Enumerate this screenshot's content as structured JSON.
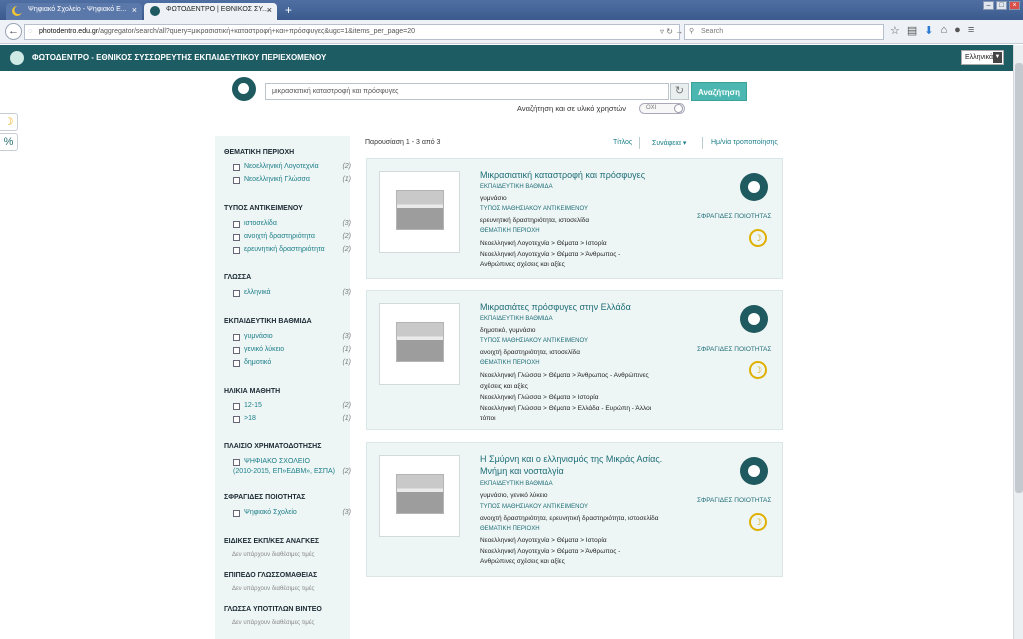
{
  "browser": {
    "tabs": [
      {
        "title": "Ψηφιακό Σχολείο - Ψηφιακό Ε..."
      },
      {
        "title": "ΦΩΤΟΔΕΝΤΡΟ | ΕΘΝΙΚΟΣ ΣΥ..."
      }
    ],
    "new_tab": "+",
    "url_host": "photodentro.edu.gr",
    "url_path": "/aggregator/search/all?query=μικρασιατική+καταστροφή+και+πρόσφυγες&ugc=1&items_per_page=20",
    "search_placeholder": "Search",
    "close_glyph": "×"
  },
  "site": {
    "title": "ΦΩΤΟΔΕΝΤΡΟ - ΕΘΝΙΚΟΣ ΣΥΣΣΩΡΕΥΤΗΣ ΕΚΠΑΙΔΕΥΤΙΚΟΥ ΠΕΡΙΕΧΟΜΕΝΟΥ",
    "language": "Ελληνικά"
  },
  "search": {
    "query": "μικρασιατική καταστροφή και πρόσφυγες",
    "button": "Αναζήτηση",
    "user_materials_label": "Αναζήτηση και σε υλικό χρηστών",
    "toggle_value": "ΟΧΙ"
  },
  "facets": [
    {
      "heading": "ΘΕΜΑΤΙΚΗ ΠΕΡΙΟΧΗ",
      "items": [
        {
          "label": "Νεοελληνική Λογοτεχνία",
          "count": "(2)"
        },
        {
          "label": "Νεοελληνική Γλώσσα",
          "count": "(1)"
        }
      ]
    },
    {
      "heading": "ΤΥΠΟΣ ΑΝΤΙΚΕΙΜΕΝΟΥ",
      "items": [
        {
          "label": "ιστοσελίδα",
          "count": "(3)"
        },
        {
          "label": "ανοιχτή δραστηριότητα",
          "count": "(2)"
        },
        {
          "label": "ερευνητική δραστηριότητα",
          "count": "(2)"
        }
      ]
    },
    {
      "heading": "ΓΛΩΣΣΑ",
      "items": [
        {
          "label": "ελληνικά",
          "count": "(3)"
        }
      ]
    },
    {
      "heading": "ΕΚΠΑΙΔΕΥΤΙΚΗ ΒΑΘΜΙΔΑ",
      "items": [
        {
          "label": "γυμνάσιο",
          "count": "(3)"
        },
        {
          "label": "γενικό λύκειο",
          "count": "(1)"
        },
        {
          "label": "δημοτικό",
          "count": "(1)"
        }
      ]
    },
    {
      "heading": "ΗΛΙΚΙΑ ΜΑΘΗΤΗ",
      "items": [
        {
          "label": "12-15",
          "count": "(2)"
        },
        {
          "label": ">18",
          "count": "(1)"
        }
      ]
    },
    {
      "heading": "ΠΛΑΙΣΙΟ ΧΡΗΜΑΤΟΔΟΤΗΣΗΣ",
      "items": [
        {
          "label": "ΨΗΦΙΑΚΟ ΣΧΟΛΕΙΟ",
          "label2": "(2010-2015, ΕΠ»ΕΔΒΜ», ΕΣΠΑ)",
          "count": "(2)"
        }
      ]
    },
    {
      "heading": "ΣΦΡΑΓΙΔΕΣ ΠΟΙΟΤΗΤΑΣ",
      "items": [
        {
          "label": "Ψηφιακό Σχολείο",
          "count": "(3)"
        }
      ]
    },
    {
      "heading": "ΕΙΔΙΚΕΣ ΕΚΠ/ΚΕΣ ΑΝΑΓΚΕΣ",
      "none": "Δεν υπάρχουν διαθέσιμες τιμές"
    },
    {
      "heading": "ΕΠΙΠΕΔΟ ΓΛΩΣΣΟΜΑΘΕΙΑΣ",
      "none": "Δεν υπάρχουν διαθέσιμες τιμές"
    },
    {
      "heading": "ΓΛΩΣΣΑ ΥΠΟΤΙΤΛΩΝ ΒΙΝΤΕΟ",
      "none": "Δεν υπάρχουν διαθέσιμες τιμές"
    }
  ],
  "results_header": {
    "showing": "Παρουσίαση 1 - 3 από 3",
    "sort_title": "Τίτλος",
    "sort_relevance": "Συνάφεια",
    "sort_date": "Ημ/νία τροποποίησης"
  },
  "results": [
    {
      "title": "Μικρασιατική καταστροφή και πρόσφυγες",
      "lines": [
        {
          "t": "ΕΚΠΑΙΔΕΥΤΙΚΗ ΒΑΘΜΙΔΑ",
          "lab": true
        },
        {
          "t": "γυμνάσιο"
        },
        {
          "t": "ΤΥΠΟΣ ΜΑΘΗΣΙΑΚΟΥ ΑΝΤΙΚΕΙΜΕΝΟΥ",
          "lab": true
        },
        {
          "t": "ερευνητική δραστηριότητα, ιστοσελίδα"
        },
        {
          "t": "ΘΕΜΑΤΙΚΗ ΠΕΡΙΟΧΗ",
          "lab": true
        },
        {
          "t": "Νεοελληνική Λογοτεχνία > Θέματα > Ιστορία"
        },
        {
          "t": "Νεοελληνική Λογοτεχνία > Θέματα > Άνθρωπος -"
        },
        {
          "t": "Ανθρώπινες σχέσεις και αξίες"
        }
      ],
      "seals": "ΣΦΡΑΓΙΔΕΣ ΠΟΙΟΤΗΤΑΣ"
    },
    {
      "title": "Μικρασιάτες πρόσφυγες στην Ελλάδα",
      "lines": [
        {
          "t": "ΕΚΠΑΙΔΕΥΤΙΚΗ ΒΑΘΜΙΔΑ",
          "lab": true
        },
        {
          "t": "δημοτικό, γυμνάσιο"
        },
        {
          "t": "ΤΥΠΟΣ ΜΑΘΗΣΙΑΚΟΥ ΑΝΤΙΚΕΙΜΕΝΟΥ",
          "lab": true
        },
        {
          "t": "ανοιχτή δραστηριότητα, ιστοσελίδα"
        },
        {
          "t": "ΘΕΜΑΤΙΚΗ ΠΕΡΙΟΧΗ",
          "lab": true
        },
        {
          "t": "Νεοελληνική Γλώσσα > Θέματα > Άνθρωπος - Ανθρώπινες"
        },
        {
          "t": "σχέσεις και αξίες"
        },
        {
          "t": "Νεοελληνική Γλώσσα > Θέματα > Ιστορία"
        },
        {
          "t": "Νεοελληνική Γλώσσα > Θέματα > Ελλάδα - Ευρώπη - Άλλοι"
        },
        {
          "t": "τόποι"
        }
      ],
      "seals": "ΣΦΡΑΓΙΔΕΣ ΠΟΙΟΤΗΤΑΣ"
    },
    {
      "title": "Η Σμύρνη και ο ελληνισμός της Μικράς Ασίας. Μνήμη και νοσταλγία",
      "lines": [
        {
          "t": "ΕΚΠΑΙΔΕΥΤΙΚΗ ΒΑΘΜΙΔΑ",
          "lab": true
        },
        {
          "t": "γυμνάσιο, γενικό λύκειο"
        },
        {
          "t": "ΤΥΠΟΣ ΜΑΘΗΣΙΑΚΟΥ ΑΝΤΙΚΕΙΜΕΝΟΥ",
          "lab": true
        },
        {
          "t": "ανοιχτή δραστηριότητα, ερευνητική δραστηριότητα, ιστοσελίδα"
        },
        {
          "t": "ΘΕΜΑΤΙΚΗ ΠΕΡΙΟΧΗ",
          "lab": true
        },
        {
          "t": "Νεοελληνική Λογοτεχνία > Θέματα > Ιστορία"
        },
        {
          "t": "Νεοελληνική Λογοτεχνία > Θέματα > Άνθρωπος -"
        },
        {
          "t": "Ανθρώπινες σχέσεις και αξίες"
        }
      ],
      "seals": "ΣΦΡΑΓΙΔΕΣ ΠΟΙΟΤΗΤΑΣ"
    }
  ]
}
